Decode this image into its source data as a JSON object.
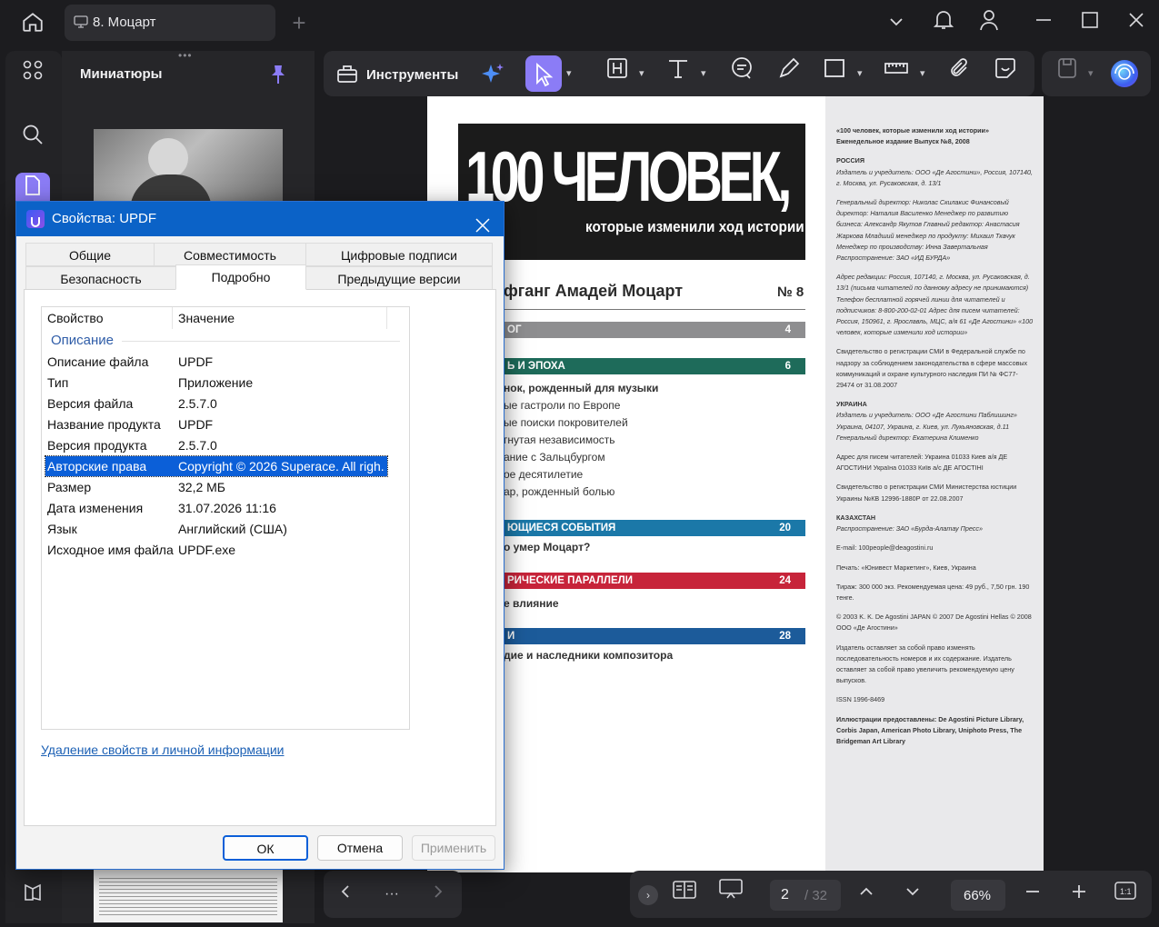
{
  "titlebar": {
    "tab_title": "8. Моцарт"
  },
  "sidebar": {
    "panel_title": "Миниатюры"
  },
  "toolbar": {
    "tools_label": "Инструменты",
    "zoom": "66%",
    "page_current": "2",
    "page_total": "/ 32"
  },
  "document": {
    "masthead": "100 ЧЕЛОВЕК,",
    "masthead_sub": "которые изменили ход истории",
    "heading": "фганг Амадей Моцарт",
    "issue": "№ 8",
    "toc": [
      {
        "title": "ОГ",
        "page": "4",
        "color": "#8e8e90"
      },
      {
        "title": "Ь И ЭПОХА",
        "page": "6",
        "color": "#1e6b5a"
      },
      {
        "title": "ЮЩИЕСЯ СОБЫТИЯ",
        "page": "20",
        "color": "#1b78a8"
      },
      {
        "title": "РИЧЕСКИЕ ПАРАЛЛЕЛИ",
        "page": "24",
        "color": "#c7243a"
      },
      {
        "title": "И",
        "page": "28",
        "color": "#1c5b9a"
      }
    ],
    "toc_lines": [
      "нок, рожденный для музыки",
      "ые гастроли по Европе",
      "ые поиски покровителей",
      "гнутая независимость",
      "ание с Зальцбургом",
      "ое десятилетие",
      "ар, рожденный болью",
      "о умер Моцарт?",
      "е влияние",
      "дие и наследники композитора"
    ],
    "right_column": [
      "«100 человек, которые изменили ход истории» Еженедельное издание Выпуск №8, 2008",
      "РОССИЯ",
      "Издатель и учредитель: ООО «Де Агостини», Россия, 107140, г. Москва, ул. Русаковская, д. 13/1",
      "Генеральный директор: Николас Скилакис Финансовый директор: Наталия Василенко Менеджер по развитию бизнеса: Александр Якутов Главный редактор: Анастасия Жаркова Младший менеджер по продукту: Михаил Ткачук Менеджер по производству: Инна Завертальная Распространение: ЗАО «ИД БУРДА»",
      "Адрес редакции: Россия, 107140, г. Москва, ул. Русаковская, д. 13/1 (письма читателей по данному адресу не принимаются) Телефон бесплатной горячей линии для читателей и подписчиков: 8-800-200-02-01 Адрес для писем читателей: Россия, 150961, г. Ярославль, МЦС, а/я 61 «Де Агостини» «100 человек, которые изменили ход истории»",
      "Свидетельство о регистрации СМИ в Федеральной службе по надзору за соблюдением законодательства в сфере массовых коммуникаций и охране культурного наследия ПИ № ФС77-29474 от 31.08.2007",
      "УКРАИНА",
      "Издатель и учредитель: ООО «Де Агостини Паблишинг» Украина, 04107, Украина, г. Киев, ул. Лукьяновская, д.11 Генеральный директор: Екатерина Клименко",
      "Адрес для писем читателей: Украина 01033 Киев а/я ДЕ АГОСТИНИ Україна 01033 Київ а/с ДЕ АГОСТІНІ",
      "Свидетельство о регистрации СМИ Министерства юстиции Украины №КВ 12996-1880Р от 22.08.2007",
      "КАЗАХСТАН",
      "Распространение: ЗАО «Бурда-Алатау Пресс»",
      "E-mail: 100people@deagostini.ru",
      "Печать: «Юнивест Маркетинг», Киев, Украина",
      "Тираж: 300 000 экз. Рекомендуемая цена: 49 руб., 7,50 грн. 190 тенге.",
      "© 2003 K. K. De Agostini JAPAN © 2007 De Agostini Hellas © 2008 ООО «Де Агостини»",
      "Издатель оставляет за собой право изменять последовательность номеров и их содержание. Издатель оставляет за собой право увеличить рекомендуемую цену выпусков.",
      "ISSN 1996-8469",
      "Иллюстрации предоставлены: De Agostini Picture Library, Corbis Japan, American Photo Library, Uniphoto Press, The Bridgeman Art Library"
    ]
  },
  "dialog": {
    "title": "Свойства: UPDF",
    "tabs": [
      "Общие",
      "Совместимость",
      "Цифровые подписи",
      "Безопасность",
      "Подробно",
      "Предыдущие версии"
    ],
    "col_property": "Свойство",
    "col_value": "Значение",
    "group": "Описание",
    "rows": [
      {
        "k": "Описание файла",
        "v": "UPDF"
      },
      {
        "k": "Тип",
        "v": "Приложение"
      },
      {
        "k": "Версия файла",
        "v": "2.5.7.0"
      },
      {
        "k": "Название продукта",
        "v": "UPDF"
      },
      {
        "k": "Версия продукта",
        "v": "2.5.7.0"
      },
      {
        "k": "Авторские права",
        "v": "Copyright © 2026 Superace. All righ..."
      },
      {
        "k": "Размер",
        "v": "32,2 МБ"
      },
      {
        "k": "Дата изменения",
        "v": "31.07.2026 11:16"
      },
      {
        "k": "Язык",
        "v": "Английский (США)"
      },
      {
        "k": "Исходное имя файла",
        "v": "UPDF.exe"
      }
    ],
    "remove_link": "Удаление свойств и личной информации",
    "ok": "ОК",
    "cancel": "Отмена",
    "apply": "Применить"
  },
  "colors": {
    "accent": "#8b7cf6",
    "dialog_title": "#0b62c7",
    "selection": "#0b5fd8",
    "link": "#1a5fb4"
  }
}
